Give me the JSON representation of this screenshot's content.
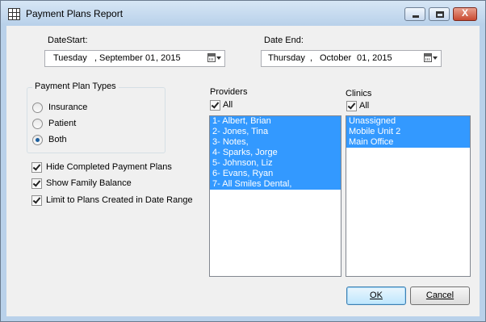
{
  "window": {
    "title": "Payment Plans Report"
  },
  "titlebar": {
    "minimize_glyph": "minimize",
    "maximize_glyph": "maximize",
    "close_glyph": "X"
  },
  "date_start": {
    "label": "DateStart:",
    "weekday": "Tuesday",
    "separator": ",",
    "month": "September",
    "day": "01",
    "year": ", 2015"
  },
  "date_end": {
    "label": "Date End:",
    "weekday": "Thursday",
    "separator": ",",
    "month": "October",
    "day": "01",
    "year": ", 2015"
  },
  "plan_types": {
    "title": "Payment Plan Types",
    "options": [
      {
        "label": "Insurance",
        "selected": false
      },
      {
        "label": "Patient",
        "selected": false
      },
      {
        "label": "Both",
        "selected": true
      }
    ]
  },
  "options": [
    {
      "label": "Hide Completed Payment Plans",
      "checked": true
    },
    {
      "label": "Show Family Balance",
      "checked": true
    },
    {
      "label": "Limit to Plans Created in Date Range",
      "checked": true
    }
  ],
  "providers": {
    "title": "Providers",
    "all_label": "All",
    "all_checked": true,
    "items": [
      "1- Albert, Brian",
      "2- Jones, Tina",
      "3- Notes,",
      "4- Sparks, Jorge",
      "5- Johnson, Liz",
      "6- Evans, Ryan",
      "7- All Smiles Dental,"
    ]
  },
  "clinics": {
    "title": "Clinics",
    "all_label": "All",
    "all_checked": true,
    "items": [
      "Unassigned",
      "Mobile Unit 2",
      "Main Office"
    ]
  },
  "buttons": {
    "ok": "OK",
    "cancel": "Cancel"
  },
  "icons": {
    "app": "grid-report-icon",
    "calendar": "calendar-dropdown-icon",
    "check": "checkmark-icon"
  },
  "colors": {
    "selection": "#3399ff",
    "titlebar": "#b9d1ea",
    "close_button": "#c94a30"
  }
}
